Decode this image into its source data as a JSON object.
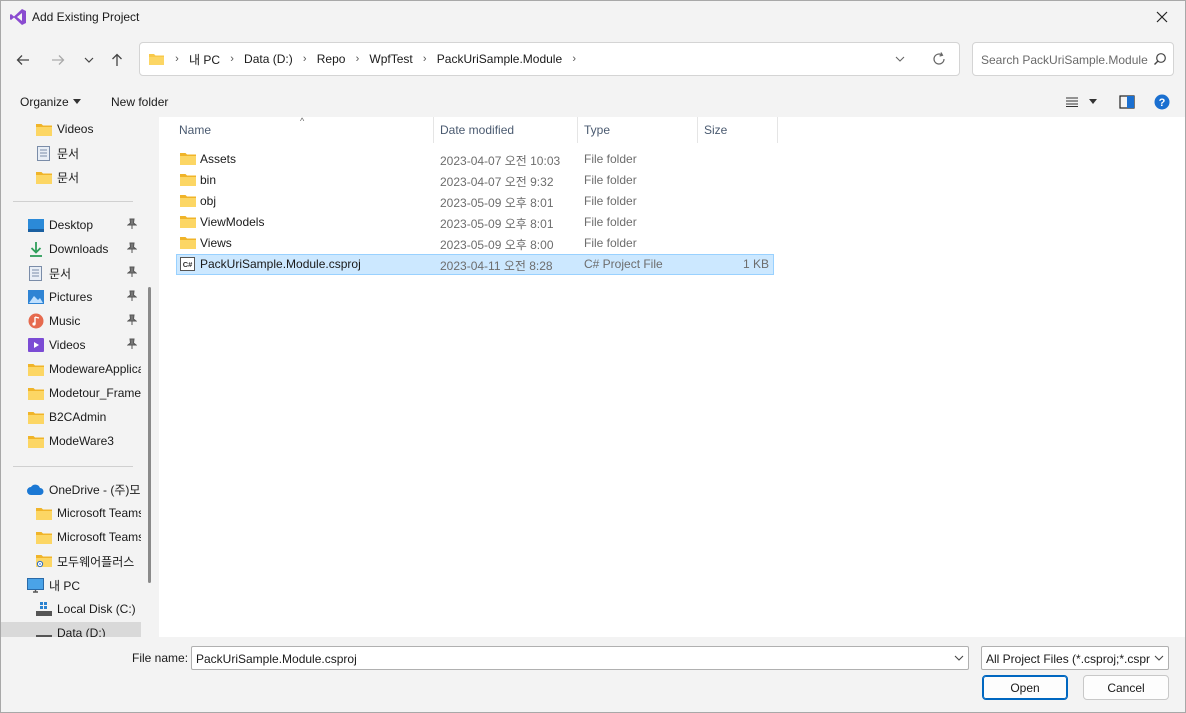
{
  "window": {
    "title": "Add Existing Project"
  },
  "address": {
    "crumbs": [
      "내 PC",
      "Data (D:)",
      "Repo",
      "WpfTest",
      "PackUriSample.Module"
    ]
  },
  "search": {
    "placeholder": "Search PackUriSample.Module"
  },
  "commands": {
    "organize": "Organize",
    "new_folder": "New folder"
  },
  "nav": {
    "items": [
      {
        "label": "Videos",
        "icon": "folder-icon"
      },
      {
        "label": "문서",
        "icon": "document-icon"
      },
      {
        "label": "문서",
        "icon": "folder-icon"
      },
      {
        "label": "Desktop",
        "icon": "desktop-icon",
        "pinned": true
      },
      {
        "label": "Downloads",
        "icon": "download-icon",
        "pinned": true
      },
      {
        "label": "문서",
        "icon": "document-icon",
        "pinned": true
      },
      {
        "label": "Pictures",
        "icon": "pictures-icon",
        "pinned": true
      },
      {
        "label": "Music",
        "icon": "music-icon",
        "pinned": true
      },
      {
        "label": "Videos",
        "icon": "videos-icon",
        "pinned": true
      },
      {
        "label": "ModewareApplica",
        "icon": "folder-icon"
      },
      {
        "label": "Modetour_Frame",
        "icon": "folder-icon"
      },
      {
        "label": "B2CAdmin",
        "icon": "folder-icon"
      },
      {
        "label": "ModeWare3",
        "icon": "folder-icon"
      },
      {
        "label": "OneDrive - (주)모",
        "icon": "onedrive-icon"
      },
      {
        "label": "Microsoft Teams",
        "icon": "folder-icon"
      },
      {
        "label": "Microsoft Teams",
        "icon": "folder-icon"
      },
      {
        "label": "모두웨어플러스",
        "icon": "shared-folder-icon"
      },
      {
        "label": "내 PC",
        "icon": "pc-icon"
      },
      {
        "label": "Local Disk (C:)",
        "icon": "drive-icon"
      },
      {
        "label": "Data (D:)",
        "icon": "drive-icon",
        "selected": true
      }
    ]
  },
  "columns": {
    "name": "Name",
    "date": "Date modified",
    "type": "Type",
    "size": "Size"
  },
  "files": [
    {
      "name": "Assets",
      "date": "2023-04-07 오전 10:03",
      "type": "File folder",
      "size": "",
      "icon": "folder-icon"
    },
    {
      "name": "bin",
      "date": "2023-04-07 오전 9:32",
      "type": "File folder",
      "size": "",
      "icon": "folder-icon"
    },
    {
      "name": "obj",
      "date": "2023-05-09 오후 8:01",
      "type": "File folder",
      "size": "",
      "icon": "folder-icon"
    },
    {
      "name": "ViewModels",
      "date": "2023-05-09 오후 8:01",
      "type": "File folder",
      "size": "",
      "icon": "folder-icon"
    },
    {
      "name": "Views",
      "date": "2023-05-09 오후 8:00",
      "type": "File folder",
      "size": "",
      "icon": "folder-icon"
    },
    {
      "name": "PackUriSample.Module.csproj",
      "date": "2023-04-11 오전 8:28",
      "type": "C# Project File",
      "size": "1 KB",
      "icon": "csproj-file-icon",
      "selected": true
    }
  ],
  "footer": {
    "file_name_label": "File name:",
    "file_name_value": "PackUriSample.Module.csproj",
    "filter_value": "All Project Files (*.csproj;*.csproj",
    "open_label": "Open",
    "cancel_label": "Cancel"
  },
  "colors": {
    "selection": "#cce8ff",
    "accent": "#0067c0",
    "folder": "#f8c94a"
  }
}
